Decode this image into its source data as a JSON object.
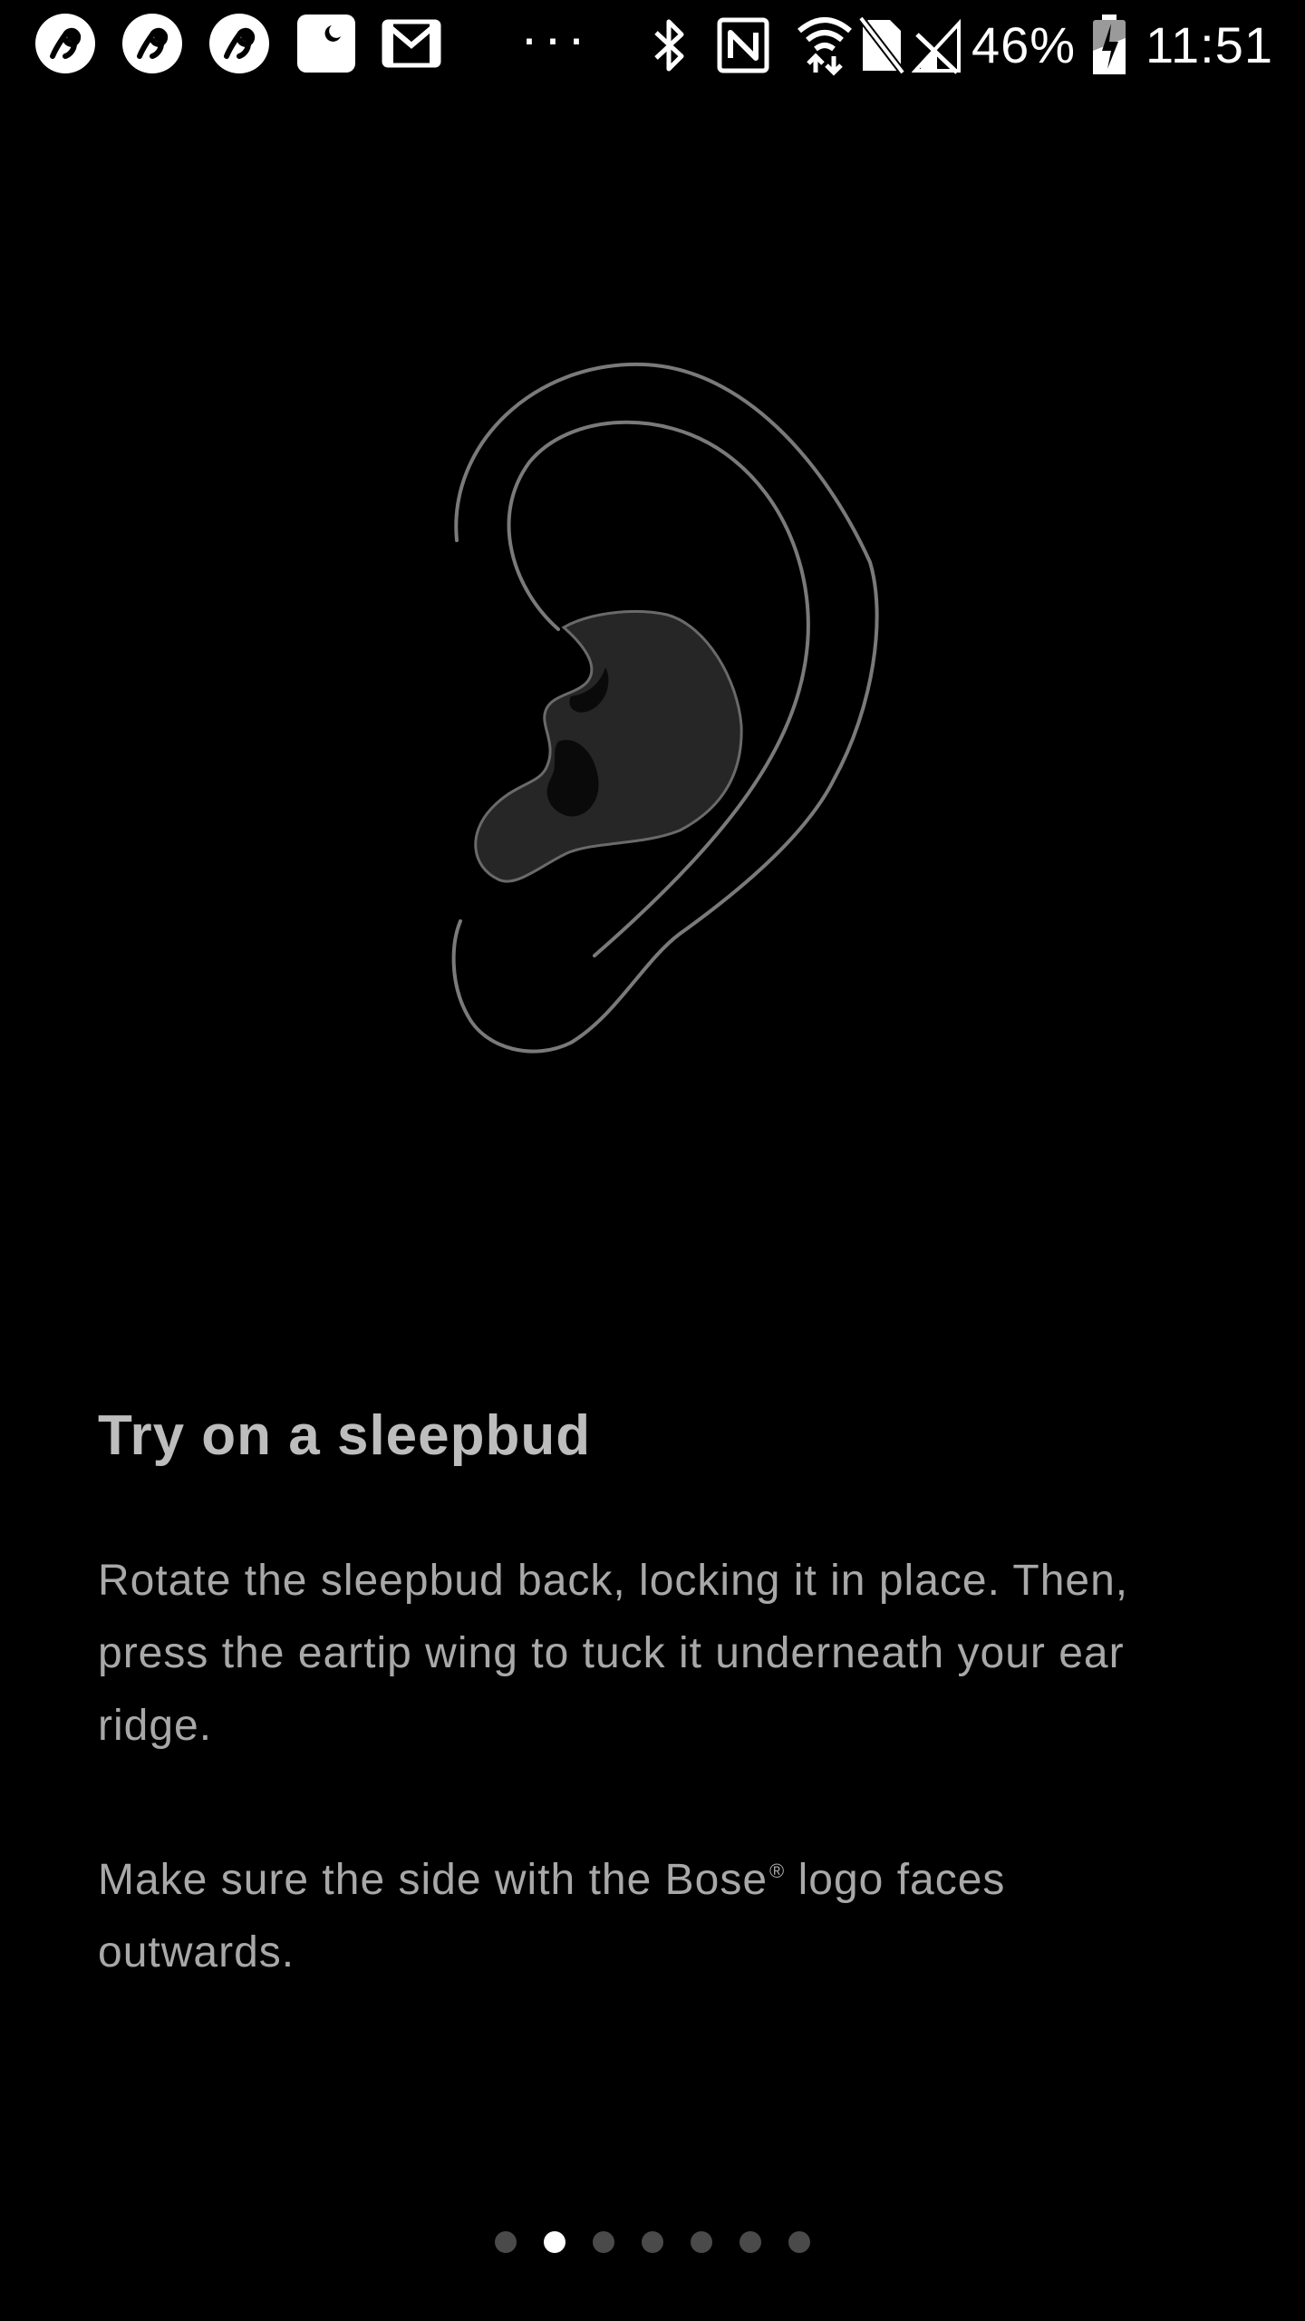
{
  "status_bar": {
    "notification_icons": [
      "sleepbuds-app-icon",
      "sleepbuds-app-icon",
      "sleepbuds-app-icon",
      "sleep-mode-icon",
      "gmail-icon"
    ],
    "overflow": "···",
    "system_icons": [
      "bluetooth-icon",
      "nfc-icon",
      "wifi-icon",
      "no-sim-icon",
      "no-signal-icon"
    ],
    "battery_percent": "46%",
    "time": "11:51"
  },
  "onboarding": {
    "title": "Try on a sleepbud",
    "paragraph_1": "Rotate the sleepbud back, locking it in place. Then, press the eartip wing to tuck it underneath your ear ridge.",
    "paragraph_2_before": "Make sure the side with the Bose",
    "paragraph_2_reg": "®",
    "paragraph_2_after": " logo faces outwards."
  },
  "pager": {
    "total_pages": 7,
    "current_page": 2
  },
  "colors": {
    "background": "#000000",
    "title": "#bdbdbd",
    "body": "#a8a8a8",
    "illustration_stroke": "#7a7a7a",
    "sleepbud_fill": "#2a2a2a",
    "dot_inactive": "#4a4a4a",
    "dot_active": "#ffffff"
  }
}
